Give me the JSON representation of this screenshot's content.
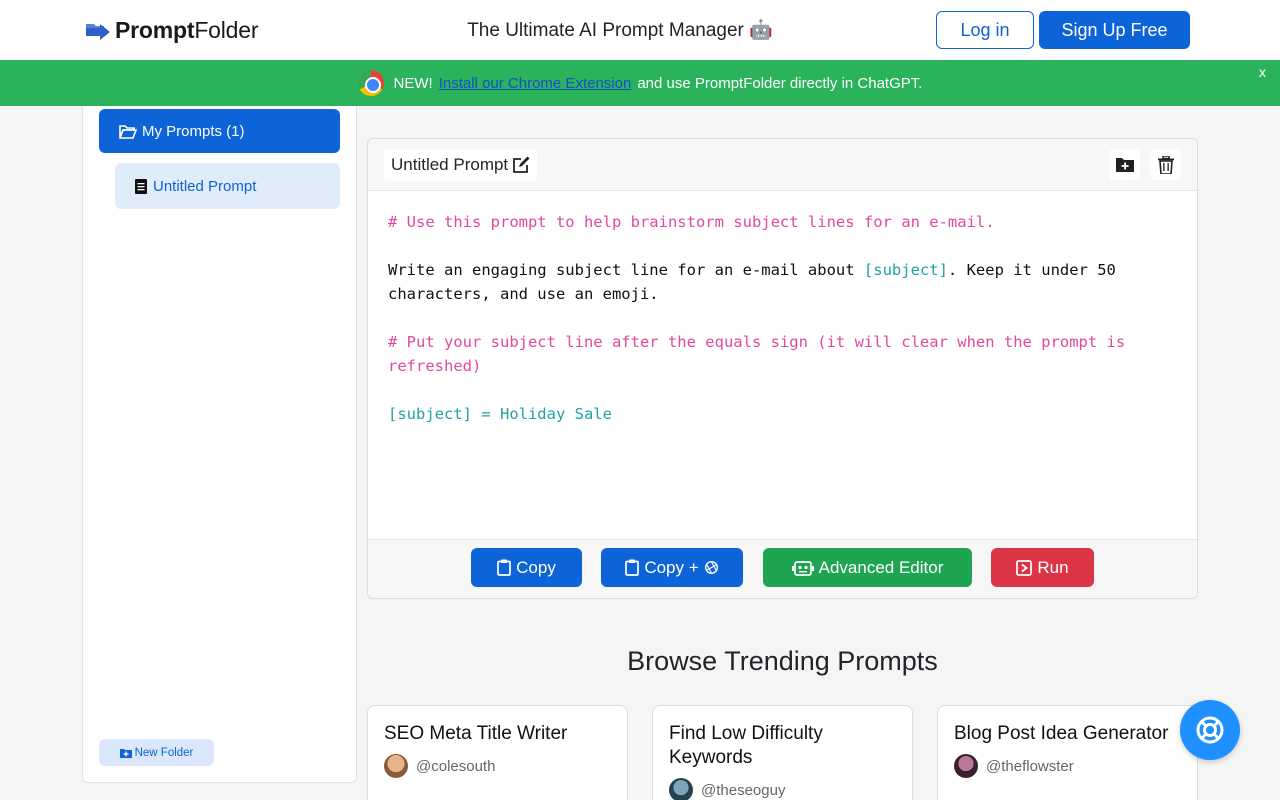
{
  "header": {
    "logo_text_bold": "Prompt",
    "logo_text_light": "Folder",
    "tagline": "The Ultimate AI Prompt Manager 🤖",
    "login_label": "Log in",
    "signup_label": "Sign Up Free"
  },
  "banner": {
    "prefix": "NEW!",
    "link_text": "Install our Chrome Extension",
    "suffix": "and use PromptFolder directly in ChatGPT.",
    "close_label": "x"
  },
  "sidebar": {
    "folder_label": "My Prompts (1)",
    "prompt_item_label": "Untitled Prompt",
    "new_folder_label": "New Folder"
  },
  "editor": {
    "title": "Untitled Prompt",
    "lines": {
      "comment1": "# Use this prompt to help brainstorm subject lines for an e-mail.",
      "body_a": "Write an engaging subject line for an e-mail about ",
      "body_var": "[subject]",
      "body_b": ". Keep it under 50 characters, and use an emoji.",
      "comment2": "# Put your subject line after the equals sign (it will clear when the prompt is refreshed)",
      "assign": "[subject] = Holiday Sale"
    },
    "buttons": {
      "copy": "Copy",
      "copy_plus": "Copy +",
      "advanced": "Advanced Editor",
      "run": "Run"
    }
  },
  "trending": {
    "title": "Browse Trending Prompts",
    "cards": [
      {
        "title": "SEO Meta Title Writer",
        "author": "@colesouth"
      },
      {
        "title": "Find Low Difficulty Keywords",
        "author": "@theseoguy"
      },
      {
        "title": "Blog Post Idea Generator",
        "author": "@theflowster"
      }
    ]
  },
  "colors": {
    "primary": "#0d63d8",
    "banner_green": "#2ab35a",
    "success": "#1fa451",
    "danger": "#dc3545",
    "comment_pink": "#e4489b",
    "variable_teal": "#1fa3a3"
  },
  "icons": {
    "logo": "folder-arrow-logo-icon",
    "chrome": "chrome-logo-icon",
    "folder_open": "folder-open-icon",
    "document": "document-icon",
    "edit": "edit-pencil-icon",
    "add_folder": "folder-plus-icon",
    "trash": "trash-icon",
    "clipboard": "clipboard-icon",
    "openai": "openai-logo-icon",
    "robot": "robot-icon",
    "run": "play-square-icon",
    "help": "lifebuoy-icon"
  }
}
